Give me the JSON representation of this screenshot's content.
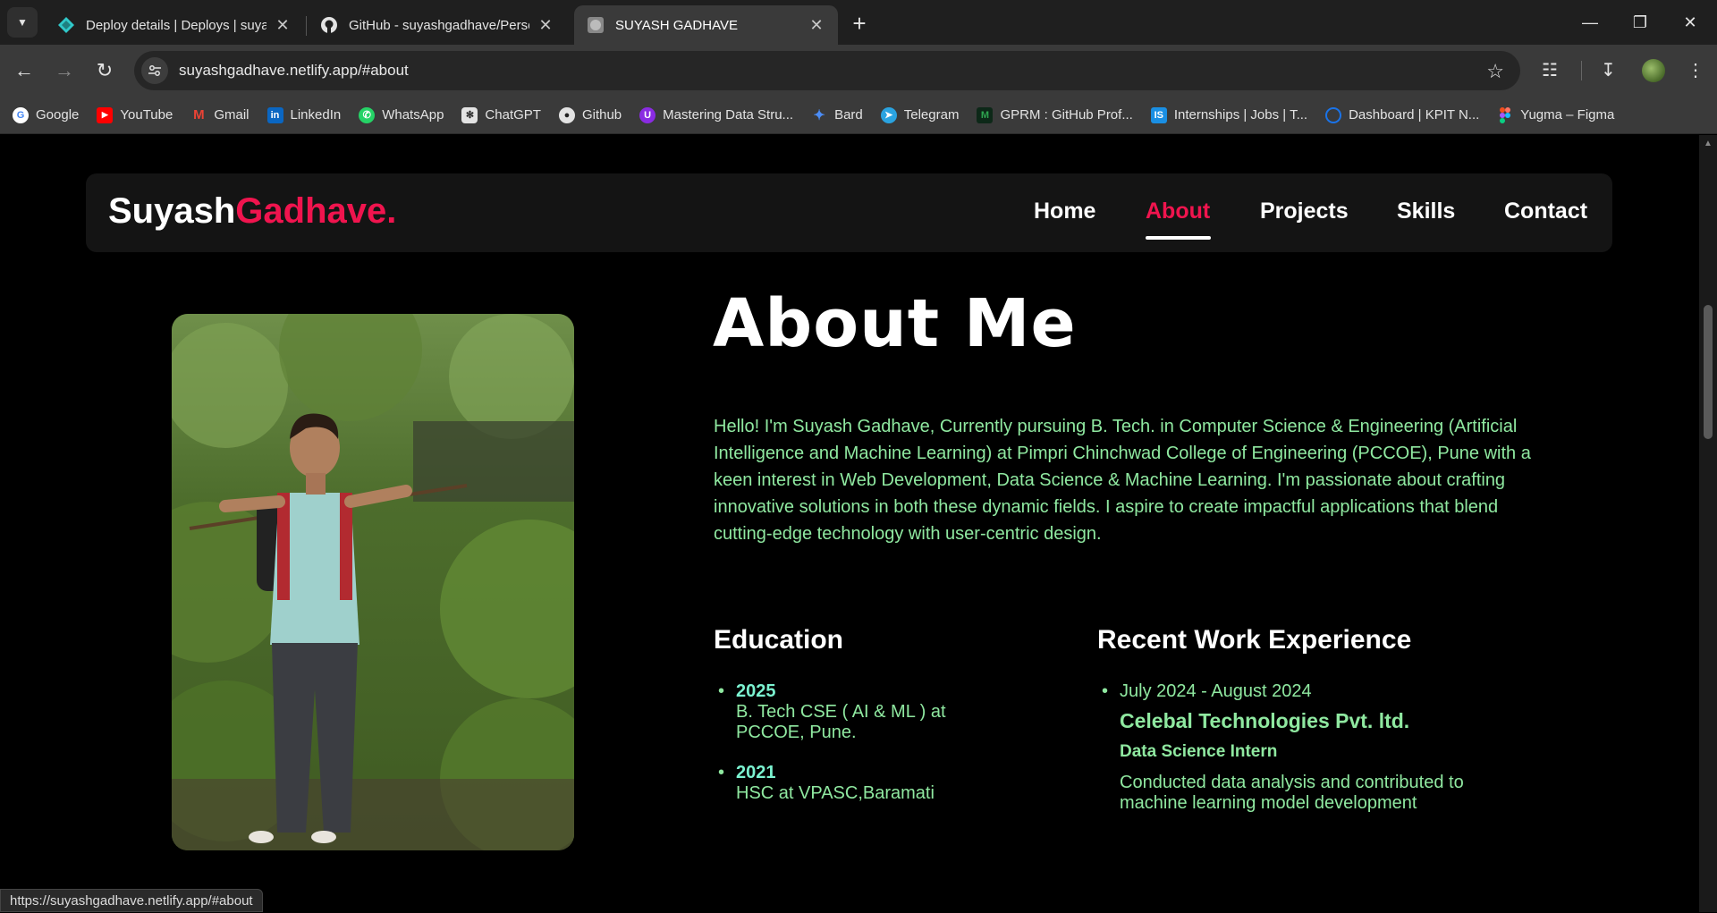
{
  "browser": {
    "tabs": [
      {
        "title": "Deploy details | Deploys | suyas",
        "icon": "netlify-icon",
        "active": false
      },
      {
        "title": "GitHub - suyashgadhave/Person",
        "icon": "github-icon",
        "active": false
      },
      {
        "title": "SUYASH GADHAVE",
        "icon": "globe-icon",
        "active": true
      }
    ],
    "url": "suyashgadhave.netlify.app/#about",
    "status_url": "https://suyashgadhave.netlify.app/#about",
    "bookmarks": [
      {
        "label": "Google",
        "icon": "google-icon",
        "color": "#4285f4"
      },
      {
        "label": "YouTube",
        "icon": "youtube-icon",
        "color": "#ff0000"
      },
      {
        "label": "Gmail",
        "icon": "gmail-icon",
        "color": "#ea4335"
      },
      {
        "label": "LinkedIn",
        "icon": "linkedin-icon",
        "color": "#0a66c2"
      },
      {
        "label": "WhatsApp",
        "icon": "whatsapp-icon",
        "color": "#25d366"
      },
      {
        "label": "ChatGPT",
        "icon": "chatgpt-icon",
        "color": "#e3e3e3"
      },
      {
        "label": "Github",
        "icon": "github-icon",
        "color": "#e3e3e3"
      },
      {
        "label": "Mastering Data Stru...",
        "icon": "course-icon",
        "color": "#8a2be2"
      },
      {
        "label": "Bard",
        "icon": "bard-icon",
        "color": "#4b8cf5"
      },
      {
        "label": "Telegram",
        "icon": "telegram-icon",
        "color": "#2aa3e0"
      },
      {
        "label": "GPRM : GitHub Prof...",
        "icon": "gprm-icon",
        "color": "#2ea44f"
      },
      {
        "label": "Internships | Jobs | T...",
        "icon": "internshala-icon",
        "color": "#1a8fe3"
      },
      {
        "label": "Dashboard | KPIT N...",
        "icon": "kpit-icon",
        "color": "#1a73e8"
      },
      {
        "label": "Yugma – Figma",
        "icon": "figma-icon",
        "color": "#f24e1e"
      }
    ]
  },
  "site": {
    "logo_first": "Suyash",
    "logo_second": "Gadhave.",
    "accent_color": "#f0144e",
    "text_color": "#8fe8a0",
    "nav": [
      {
        "label": "Home",
        "active": false
      },
      {
        "label": "About",
        "active": true
      },
      {
        "label": "Projects",
        "active": false
      },
      {
        "label": "Skills",
        "active": false
      },
      {
        "label": "Contact",
        "active": false
      }
    ]
  },
  "about": {
    "title": "About Me",
    "bio": "Hello! I'm Suyash Gadhave, Currently pursuing B. Tech. in Computer Science & Engineering (Artificial Intelligence and Machine Learning) at Pimpri Chinchwad College of Engineering (PCCOE), Pune with a keen interest in Web Development, Data Science & Machine Learning. I'm passionate about crafting innovative solutions in both these dynamic fields. I aspire to create impactful applications that blend cutting-edge technology with user-centric design.",
    "education_title": "Education",
    "education": [
      {
        "year": "2025",
        "desc": "B. Tech CSE ( AI & ML ) at PCCOE, Pune."
      },
      {
        "year": "2021",
        "desc": "HSC at VPASC,Baramati"
      }
    ],
    "experience_title": "Recent Work Experience",
    "experience": [
      {
        "date": "July 2024 - August 2024",
        "company": "Celebal Technologies Pvt. ltd.",
        "role": "Data Science Intern",
        "desc": "Conducted data analysis and contributed to machine learning model development"
      }
    ]
  }
}
